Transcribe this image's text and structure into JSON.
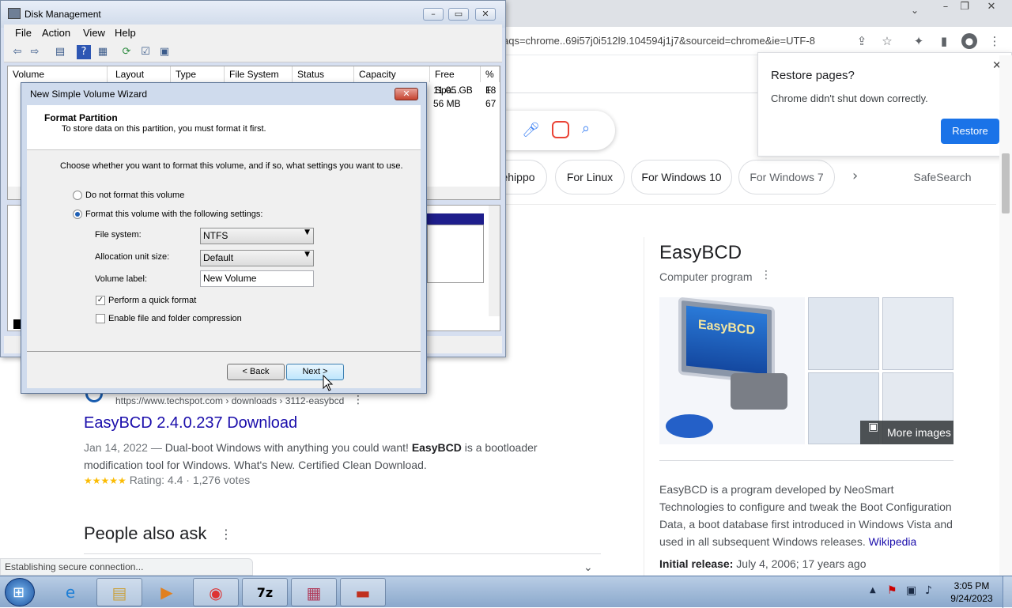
{
  "chrome": {
    "omnibox_text": "aqs=chrome..69i57j0i512l9.104594j1j7&sourceid=chrome&ie=UTF-8",
    "chips": [
      "ehippo",
      "For Linux",
      "For Windows 10",
      "For Windows 7"
    ],
    "safesearch_label": "SafeSearch",
    "restore_popup": {
      "title": "Restore pages?",
      "message": "Chrome didn't shut down correctly.",
      "button": "Restore"
    },
    "status_text": "Establishing secure connection..."
  },
  "results": {
    "url": "https://www.techspot.com › downloads › 3112-easybcd",
    "title": "EasyBCD 2.4.0.237 Download",
    "date": "Jan 14, 2022 —",
    "snippet_1": " Dual-boot Windows with anything you could want! ",
    "snippet_bold": "EasyBCD",
    "snippet_2": " is a bootloader",
    "snippet_line2": "modification tool for Windows. What's New. Certified Clean Download.",
    "stars": "★★★★★",
    "rating": "Rating: 4.4 · 1,276 votes",
    "paa_heading": "People also ask"
  },
  "knowledge_panel": {
    "title": "EasyBCD",
    "subtitle": "Computer program",
    "logo_text": "EasyBCD",
    "more_images": "More images",
    "description": "EasyBCD is a program developed by NeoSmart Technologies to configure and tweak the Boot Configuration Data, a boot database first introduced in Windows Vista and used in all subsequent Windows releases.",
    "source_link": "Wikipedia",
    "release_label": "Initial release:",
    "release_value": "July 4, 2006; 17 years ago"
  },
  "disk_mgmt": {
    "title": "Disk Management",
    "menu": [
      "File",
      "Action",
      "View",
      "Help"
    ],
    "columns": [
      "Volume",
      "Layout",
      "Type",
      "File System",
      "Status",
      "Capacity",
      "Free Spa...",
      "% F"
    ],
    "rows": [
      {
        "free": "11.05 GB",
        "pct": "18"
      },
      {
        "free": "56 MB",
        "pct": "67"
      }
    ]
  },
  "wizard": {
    "title": "New Simple Volume Wizard",
    "heading": "Format Partition",
    "subheading": "To store data on this partition, you must format it first.",
    "instruction": "Choose whether you want to format this volume, and if so, what settings you want to use.",
    "opt_no_format": "Do not format this volume",
    "opt_format": "Format this volume with the following settings:",
    "fs_label": "File system:",
    "fs_value": "NTFS",
    "alloc_label": "Allocation unit size:",
    "alloc_value": "Default",
    "vol_label": "Volume label:",
    "vol_value": "New Volume",
    "quick_format": "Perform a quick format",
    "compression": "Enable file and folder compression",
    "back": "< Back",
    "next": "Next >"
  },
  "taskbar": {
    "time": "3:05 PM",
    "date": "9/24/2023"
  }
}
